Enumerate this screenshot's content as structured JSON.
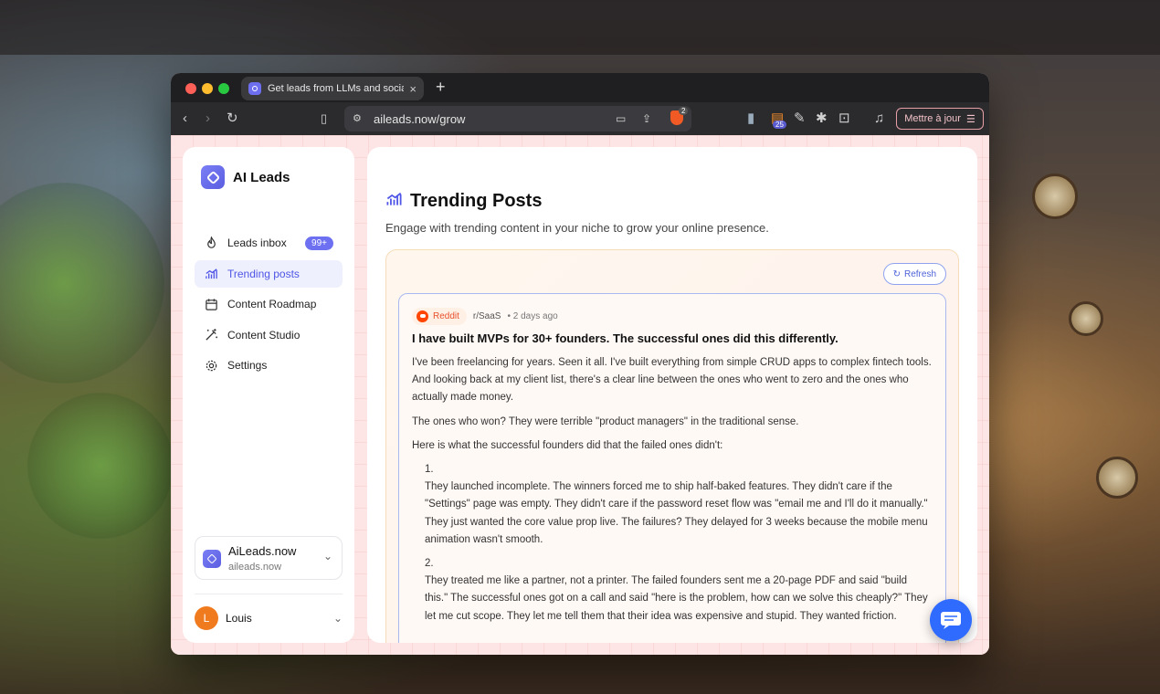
{
  "browser": {
    "tab_title": "Get leads from LLMs and social media",
    "tab_close": "×",
    "new_tab": "+",
    "url": "aileads.now/grow",
    "brave_badge": "2",
    "ext_badge_count": "25",
    "update_button": "Mettre à jour"
  },
  "sidebar": {
    "brand": "AI Leads",
    "nav": [
      {
        "label": "Leads inbox",
        "icon": "flame-icon",
        "badge": "99+"
      },
      {
        "label": "Trending posts",
        "icon": "trending-chart-icon",
        "active": true
      },
      {
        "label": "Content Roadmap",
        "icon": "calendar-icon"
      },
      {
        "label": "Content Studio",
        "icon": "magic-wand-icon"
      },
      {
        "label": "Settings",
        "icon": "gear-icon"
      }
    ],
    "workspace": {
      "name": "AiLeads.now",
      "domain": "aileads.now"
    },
    "user": {
      "initial": "L",
      "name": "Louis"
    }
  },
  "main": {
    "title": "Trending Posts",
    "subtitle": "Engage with trending content in your niche to grow your online presence.",
    "refresh_label": "Refresh",
    "post": {
      "platform": "Reddit",
      "subreddit": "r/SaaS",
      "age": "• 2 days ago",
      "title": "I have built MVPs for 30+ founders. The successful ones did this differently.",
      "p1": "I've been freelancing for years. Seen it all. I've built everything from simple CRUD apps to complex fintech tools. And looking back at my client list, there's a clear line between the ones who went to zero and the ones who actually made money.",
      "p2": "The ones who won? They were terrible \"product managers\" in the traditional sense.",
      "p3": "Here is what the successful founders did that the failed ones didn't:",
      "n1": "1.",
      "item1": "They launched incomplete. The winners forced me to ship half-baked features. They didn't care if the \"Settings\" page was empty. They didn't care if the password reset flow was \"email me and I'll do it manually.\" They just wanted the core value prop live. The failures? They delayed for 3 weeks because the mobile menu animation wasn't smooth.",
      "n2": "2.",
      "item2": "They treated me like a partner, not a printer. The failed founders sent me a 20-page PDF and said \"build this.\" The successful ones got on a call and said \"here is the problem, how can we solve this cheaply?\" They let me cut scope. They let me tell them that their idea was expensive and stupid. They wanted friction."
    }
  },
  "colors": {
    "accent": "#6d70f0",
    "active_text": "#4f55e6",
    "reddit": "#ff4500",
    "chat_fab": "#2f6bff",
    "avatar": "#f07a1e"
  }
}
